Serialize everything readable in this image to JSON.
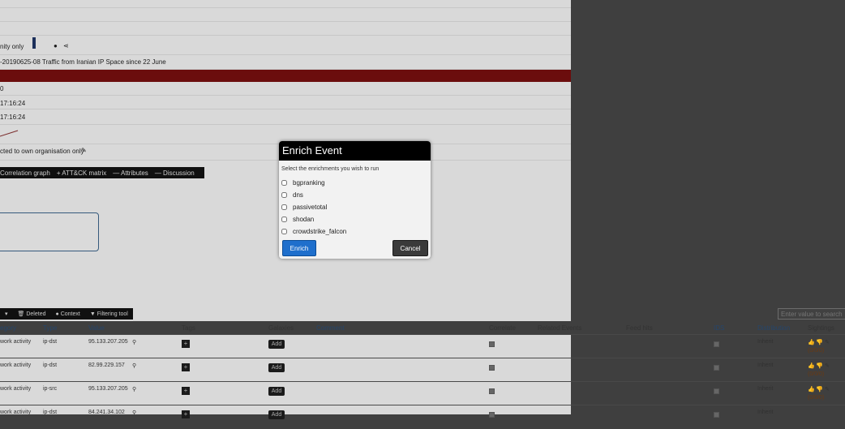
{
  "event": {
    "distribution_text": "nity only",
    "info": "-20190625-08 Traffic from Iranian IP Space since 22 June",
    "count_row": "0",
    "date1": "17:16:24",
    "date2": "17:16:24",
    "restriction": "cted to own organisation only"
  },
  "toolbar": {
    "correlation": "Correlation graph",
    "attack": "ATT&CK matrix",
    "attributes": "Attributes",
    "discussion": "Discussion"
  },
  "attr_toolbar": {
    "deleted": "Deleted",
    "context": "Context",
    "filtering": "Filtering tool"
  },
  "search": {
    "placeholder": "Enter value to search"
  },
  "table": {
    "headers": {
      "category": "egory",
      "type": "Type",
      "value": "Value",
      "tags": "Tags",
      "galaxies": "Galaxies",
      "comment": "Comment",
      "correlate": "Correlate",
      "related": "Related Events",
      "feed": "Feed hits",
      "ids": "IDS",
      "distribution": "Distribution",
      "sightings": "Sightings"
    },
    "rows": [
      {
        "category": "work activity",
        "type": "ip-dst",
        "value": "95.133.207.205",
        "distribution": "Inherit",
        "sightings": "(0/0/0)",
        "add": "Add",
        "plus": "+"
      },
      {
        "category": "work activity",
        "type": "ip-dst",
        "value": "82.99.229.157",
        "distribution": "Inherit",
        "sightings": "(0/0/0)",
        "add": "Add",
        "plus": "+"
      },
      {
        "category": "work activity",
        "type": "ip-src",
        "value": "95.133.207.205",
        "distribution": "Inherit",
        "sightings": "(0/0/0)",
        "add": "Add",
        "plus": "+"
      },
      {
        "category": "work activity",
        "type": "ip-dst",
        "value": "84.241.34.102",
        "distribution": "Inherit",
        "sightings": "",
        "add": "Add",
        "plus": "+"
      }
    ]
  },
  "modal": {
    "title": "Enrich Event",
    "subtitle": "Select the enrichments you wish to run",
    "options": [
      "bgpranking",
      "dns",
      "passivetotal",
      "shodan",
      "crowdstrike_falcon"
    ],
    "enrich_label": "Enrich",
    "cancel_label": "Cancel"
  }
}
